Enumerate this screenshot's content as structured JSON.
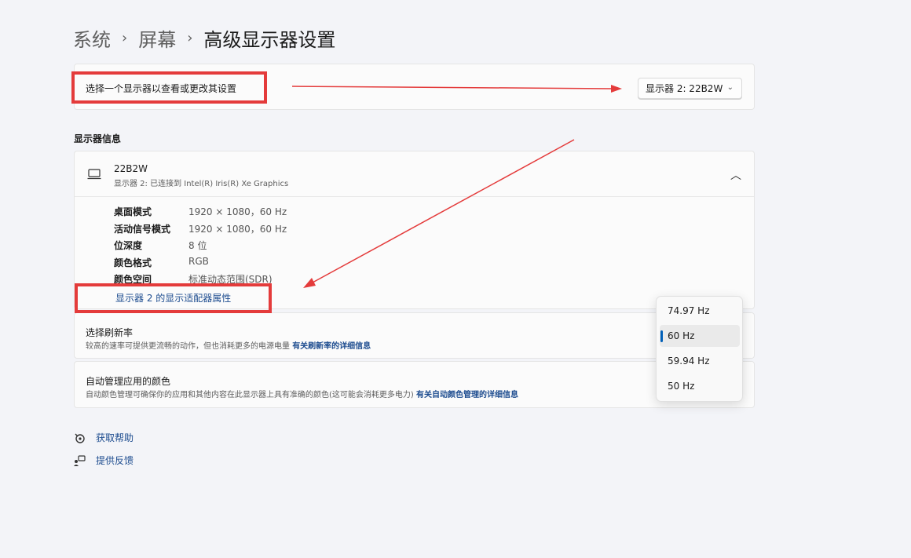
{
  "breadcrumb": {
    "items": [
      "系统",
      "屏幕"
    ],
    "current": "高级显示器设置",
    "separator": "›"
  },
  "select_display": {
    "label": "选择一个显示器以查看或更改其设置",
    "dropdown_value": "显示器 2: 22B2W"
  },
  "display_info": {
    "section_title": "显示器信息",
    "name": "22B2W",
    "subtitle": "显示器 2: 已连接到 Intel(R) Iris(R) Xe Graphics",
    "rows": [
      {
        "key": "桌面模式",
        "value": "1920 × 1080，60 Hz"
      },
      {
        "key": "活动信号模式",
        "value": "1920 × 1080，60 Hz"
      },
      {
        "key": "位深度",
        "value": "8 位"
      },
      {
        "key": "颜色格式",
        "value": "RGB"
      },
      {
        "key": "颜色空间",
        "value": "标准动态范围(SDR)"
      }
    ],
    "adapter_link": "显示器 2 的显示适配器属性"
  },
  "refresh_rate": {
    "title": "选择刷新率",
    "desc": "较高的速率可提供更流畅的动作，但也消耗更多的电源电量",
    "link": "有关刷新率的详细信息"
  },
  "auto_color": {
    "title": "自动管理应用的颜色",
    "desc": "自动颜色管理可确保你的应用和其他内容在此显示器上具有准确的颜色(这可能会消耗更多电力)",
    "link": "有关自动颜色管理的详细信息"
  },
  "refresh_options": {
    "items": [
      "74.97 Hz",
      "60 Hz",
      "59.94 Hz",
      "50 Hz"
    ],
    "selected": "60 Hz"
  },
  "footer": {
    "help": "获取帮助",
    "feedback": "提供反馈"
  },
  "colors": {
    "accent": "#005fb8",
    "link": "#1d4c8f",
    "annotation": "#e43b3b"
  },
  "icons": {
    "monitor": "monitor-icon",
    "collapse": "chevron-up-icon",
    "dropdown": "chevron-down-icon",
    "help": "help-icon",
    "feedback": "feedback-icon"
  }
}
